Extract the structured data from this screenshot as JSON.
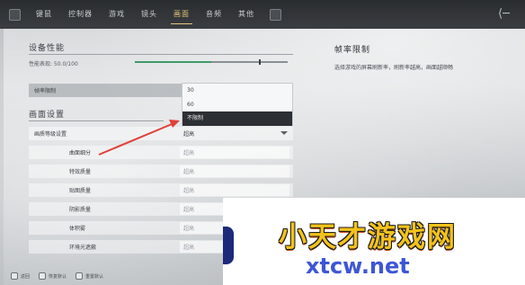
{
  "nav": {
    "tabs": [
      "键鼠",
      "控制器",
      "游戏",
      "镜头",
      "画面",
      "音频",
      "其他"
    ],
    "active_tab": "画面"
  },
  "left": {
    "perf_title": "设备性能",
    "perf_label": "性能表现: 50.0/100",
    "perf_value": 0.5,
    "frame_limit_label": "帧率限制",
    "display_title": "画面设置",
    "global_quality_label": "画质等级设置",
    "global_quality_value": "超高",
    "sub_settings": [
      {
        "label": "曲面细分",
        "value": "超高"
      },
      {
        "label": "特效质量",
        "value": "超高"
      },
      {
        "label": "贴图质量",
        "value": "超高"
      },
      {
        "label": "阴影质量",
        "value": "超高"
      },
      {
        "label": "体积雾",
        "value": "超高"
      },
      {
        "label": "环境光遮蔽",
        "value": "超高"
      }
    ]
  },
  "dropdown": {
    "options": [
      "30",
      "60",
      "不限制"
    ],
    "selected": "不限制"
  },
  "right": {
    "title": "帧率限制",
    "description": "选择游戏的屏幕刷新率，刷新率越高，画面越顺畅"
  },
  "hints": [
    {
      "label": "返回"
    },
    {
      "label": "恢复默认"
    },
    {
      "label": "重置默认"
    }
  ],
  "watermark": {
    "cn": "小天才游戏网",
    "en": "xtcw.net"
  },
  "colors": {
    "accent": "#e7c77b",
    "bar_fill": "#3f9a6a",
    "arrow": "#e0403a",
    "watermark_yellow": "#f4c21b",
    "watermark_blue": "#3d56d6"
  }
}
